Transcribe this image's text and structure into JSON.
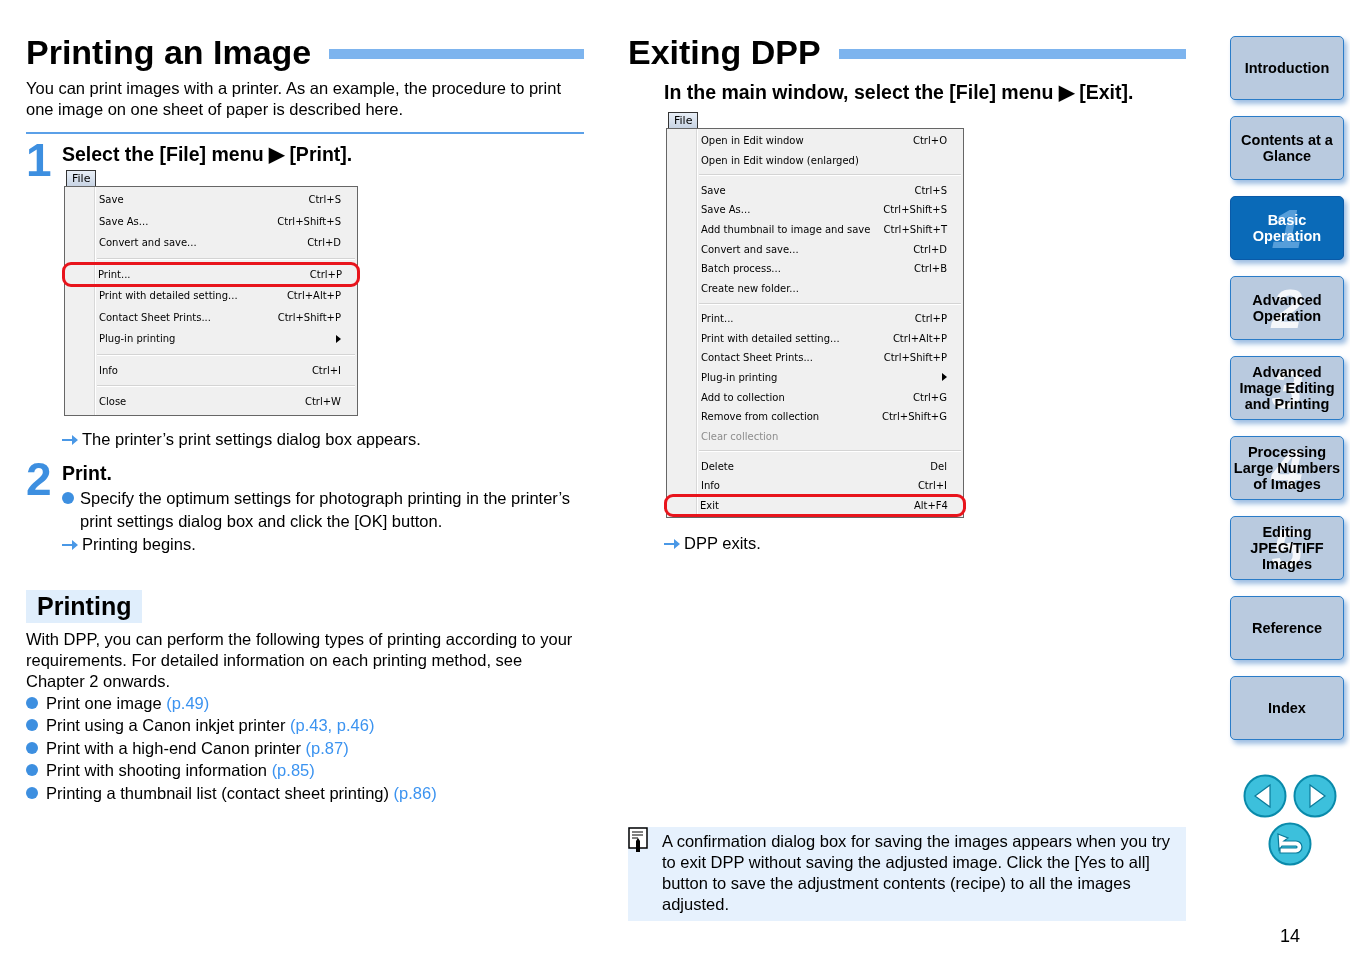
{
  "left": {
    "title": "Printing an Image",
    "intro": "You can print images with a printer. As an example, the procedure to print one image on one sheet of paper is described here.",
    "steps": [
      {
        "number": "1",
        "title": "Select the [File] menu ▶ [Print].",
        "menu": {
          "tab": "File",
          "groups": [
            [
              {
                "kind": "item",
                "label": "Save",
                "shortcut": "Ctrl+S",
                "highlighted": false,
                "disabled": false
              },
              {
                "kind": "item",
                "label": "Save As...",
                "shortcut": "Ctrl+Shift+S",
                "highlighted": false,
                "disabled": false
              },
              {
                "kind": "item",
                "label": "Convert and save...",
                "shortcut": "Ctrl+D",
                "highlighted": false,
                "disabled": false
              }
            ],
            [
              {
                "kind": "item",
                "label": "Print...",
                "shortcut": "Ctrl+P",
                "highlighted": true,
                "disabled": false
              },
              {
                "kind": "item",
                "label": "Print with detailed setting...",
                "shortcut": "Ctrl+Alt+P",
                "highlighted": false,
                "disabled": false
              },
              {
                "kind": "item",
                "label": "Contact Sheet Prints...",
                "shortcut": "Ctrl+Shift+P",
                "highlighted": false,
                "disabled": false
              },
              {
                "kind": "submenu",
                "label": "Plug-in printing",
                "highlighted": false,
                "disabled": false
              }
            ],
            [
              {
                "kind": "item",
                "label": "Info",
                "shortcut": "Ctrl+I",
                "highlighted": false,
                "disabled": false
              }
            ],
            [
              {
                "kind": "item",
                "label": "Close",
                "shortcut": "Ctrl+W",
                "highlighted": false,
                "disabled": false
              }
            ]
          ]
        },
        "lines": [
          {
            "kind": "result",
            "text": "The printer’s print settings dialog box appears."
          }
        ]
      },
      {
        "number": "2",
        "title": "Print.",
        "lines": [
          {
            "kind": "bullet",
            "text": "Specify the optimum settings for photograph printing in the printer’s print settings dialog box and click the [OK] button."
          },
          {
            "kind": "result",
            "text": "Printing begins."
          }
        ]
      }
    ],
    "section": {
      "heading": "Printing",
      "text": "With DPP, you can perform the following types of printing according to your requirements. For detailed information on each printing method, see Chapter 2 onwards.",
      "items": [
        {
          "text": "Print one image",
          "link": "(p.49)"
        },
        {
          "text": "Print using a Canon inkjet printer",
          "link": "(p.43, p.46)"
        },
        {
          "text": "Print with a high-end Canon printer",
          "link": "(p.87)"
        },
        {
          "text": "Print with shooting information",
          "link": "(p.85)"
        },
        {
          "text": "Printing a thumbnail list (contact sheet printing)",
          "link": "(p.86)"
        }
      ]
    }
  },
  "right": {
    "title": "Exiting DPP",
    "instruction": "In the main window, select the [File] menu ▶ [Exit].",
    "menu": {
      "tab": "File",
      "groups": [
        [
          {
            "kind": "item",
            "label": "Open in Edit window",
            "shortcut": "Ctrl+O",
            "highlighted": false,
            "disabled": false
          },
          {
            "kind": "item",
            "label": "Open in Edit window (enlarged)",
            "highlighted": false,
            "disabled": false
          }
        ],
        [
          {
            "kind": "item",
            "label": "Save",
            "shortcut": "Ctrl+S",
            "highlighted": false,
            "disabled": false
          },
          {
            "kind": "item",
            "label": "Save As...",
            "shortcut": "Ctrl+Shift+S",
            "highlighted": false,
            "disabled": false
          },
          {
            "kind": "item",
            "label": "Add thumbnail to image and save",
            "shortcut": "Ctrl+Shift+T",
            "highlighted": false,
            "disabled": false
          },
          {
            "kind": "item",
            "label": "Convert and save...",
            "shortcut": "Ctrl+D",
            "highlighted": false,
            "disabled": false
          },
          {
            "kind": "item",
            "label": "Batch process...",
            "shortcut": "Ctrl+B",
            "highlighted": false,
            "disabled": false
          },
          {
            "kind": "item",
            "label": "Create new folder...",
            "highlighted": false,
            "disabled": false
          }
        ],
        [
          {
            "kind": "item",
            "label": "Print...",
            "shortcut": "Ctrl+P",
            "highlighted": false,
            "disabled": false
          },
          {
            "kind": "item",
            "label": "Print with detailed setting...",
            "shortcut": "Ctrl+Alt+P",
            "highlighted": false,
            "disabled": false
          },
          {
            "kind": "item",
            "label": "Contact Sheet Prints...",
            "shortcut": "Ctrl+Shift+P",
            "highlighted": false,
            "disabled": false
          },
          {
            "kind": "submenu",
            "label": "Plug-in printing",
            "highlighted": false,
            "disabled": false
          },
          {
            "kind": "item",
            "label": "Add to collection",
            "shortcut": "Ctrl+G",
            "highlighted": false,
            "disabled": false
          },
          {
            "kind": "item",
            "label": "Remove from collection",
            "shortcut": "Ctrl+Shift+G",
            "highlighted": false,
            "disabled": false
          },
          {
            "kind": "item",
            "label": "Clear collection",
            "highlighted": false,
            "disabled": true
          }
        ],
        [
          {
            "kind": "item",
            "label": "Delete",
            "shortcut": "Del",
            "highlighted": false,
            "disabled": false
          },
          {
            "kind": "item",
            "label": "Info",
            "shortcut": "Ctrl+I",
            "highlighted": false,
            "disabled": false
          },
          {
            "kind": "item",
            "label": "Exit",
            "shortcut": "Alt+F4",
            "highlighted": true,
            "disabled": false
          }
        ]
      ]
    },
    "result": "DPP exits.",
    "note": "A confirmation dialog box for saving the images appears when you try to exit DPP without saving the adjusted image. Click the [Yes to all] button to save the adjustment contents (recipe) to all the images adjusted."
  },
  "nav": {
    "items": [
      {
        "label": "Introduction",
        "selected": false
      },
      {
        "label": "Contents at a Glance",
        "selected": false
      },
      {
        "label": "Basic Operation",
        "numeral": "1",
        "selected": true
      },
      {
        "label": "Advanced Operation",
        "numeral": "2",
        "selected": false
      },
      {
        "label": "Advanced Image Editing and Printing",
        "numeral": "3",
        "selected": false
      },
      {
        "label": "Processing Large Numbers of Images",
        "numeral": "4",
        "selected": false
      },
      {
        "label": "Editing JPEG/TIFF Images",
        "numeral": "5",
        "selected": false
      },
      {
        "label": "Reference",
        "selected": false
      },
      {
        "label": "Index",
        "selected": false
      }
    ],
    "page_number": "14"
  }
}
